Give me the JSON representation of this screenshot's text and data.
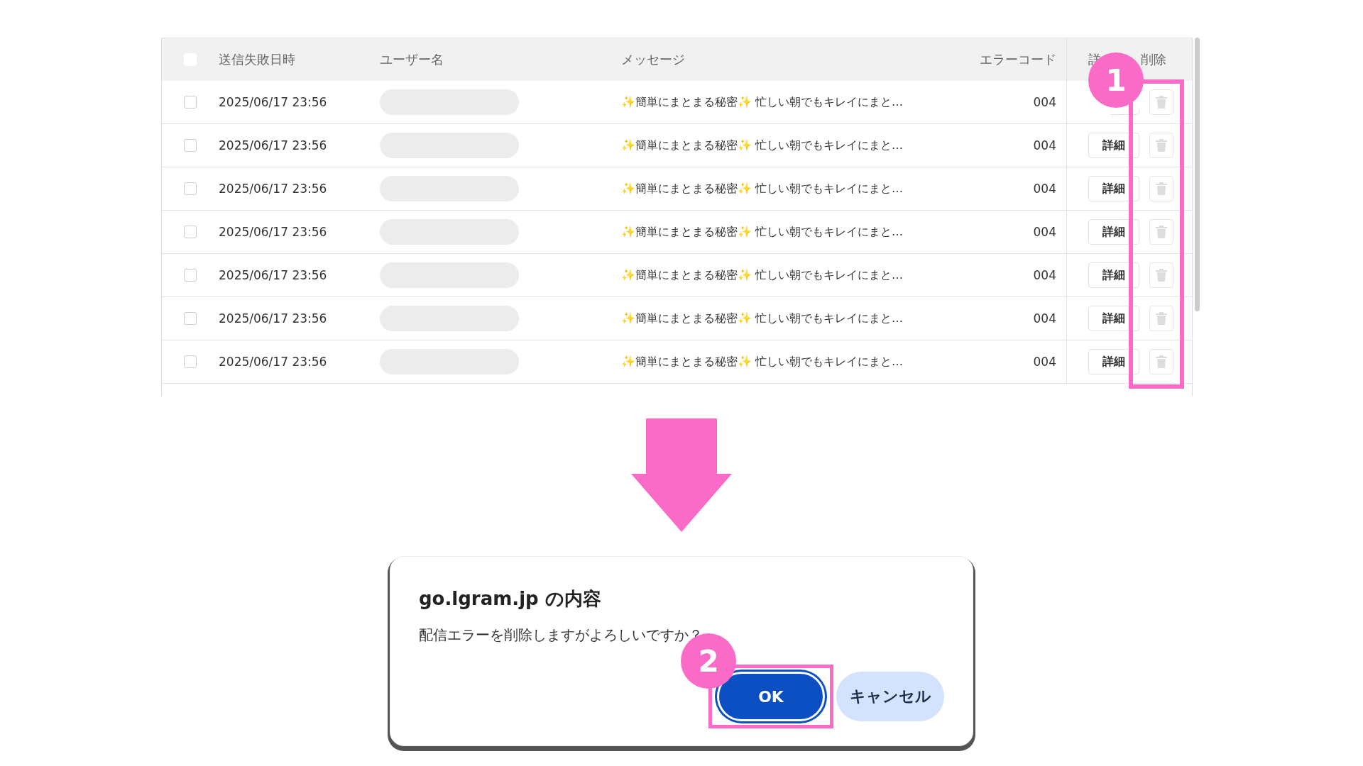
{
  "table": {
    "header_checkbox": {
      "checked": false
    },
    "columns": [
      "送信失敗日時",
      "ユーザー名",
      "メッセージ",
      "エラーコード",
      "詳",
      "削除"
    ],
    "rows": [
      {
        "checked": false,
        "date": "2025/06/17 23:56",
        "message": "✨簡単にまとまる秘密✨ 忙しい朝でもキレイにまと…",
        "error_code": "004"
      },
      {
        "checked": false,
        "date": "2025/06/17 23:56",
        "message": "✨簡単にまとまる秘密✨ 忙しい朝でもキレイにまと…",
        "error_code": "004",
        "detail_button": "詳細"
      },
      {
        "checked": false,
        "date": "2025/06/17 23:56",
        "message": "✨簡単にまとまる秘密✨ 忙しい朝でもキレイにまと…",
        "error_code": "004",
        "detail_button": "詳細"
      },
      {
        "checked": false,
        "date": "2025/06/17 23:56",
        "message": "✨簡単にまとまる秘密✨ 忙しい朝でもキレイにまと…",
        "error_code": "004",
        "detail_button": "詳細"
      },
      {
        "checked": false,
        "date": "2025/06/17 23:56",
        "message": "✨簡単にまとまる秘密✨ 忙しい朝でもキレイにまと…",
        "error_code": "004",
        "detail_button": "詳細"
      },
      {
        "checked": false,
        "date": "2025/06/17 23:56",
        "message": "✨簡単にまとまる秘密✨ 忙しい朝でもキレイにまと…",
        "error_code": "004",
        "detail_button": "詳細"
      },
      {
        "checked": false,
        "date": "2025/06/17 23:56",
        "message": "✨簡単にまとまる秘密✨ 忙しい朝でもキレイにまと…",
        "error_code": "004",
        "detail_button": "詳細"
      }
    ]
  },
  "callouts": [
    {
      "number": "1"
    },
    {
      "number": "2"
    }
  ],
  "dialog": {
    "title": "go.lgram.jp の内容",
    "message": "配信エラーを削除しますがよろしいですか？",
    "buttons": [
      {
        "label": "OK",
        "kind": "primary"
      },
      {
        "label": "キャンセル",
        "kind": "secondary"
      }
    ]
  }
}
